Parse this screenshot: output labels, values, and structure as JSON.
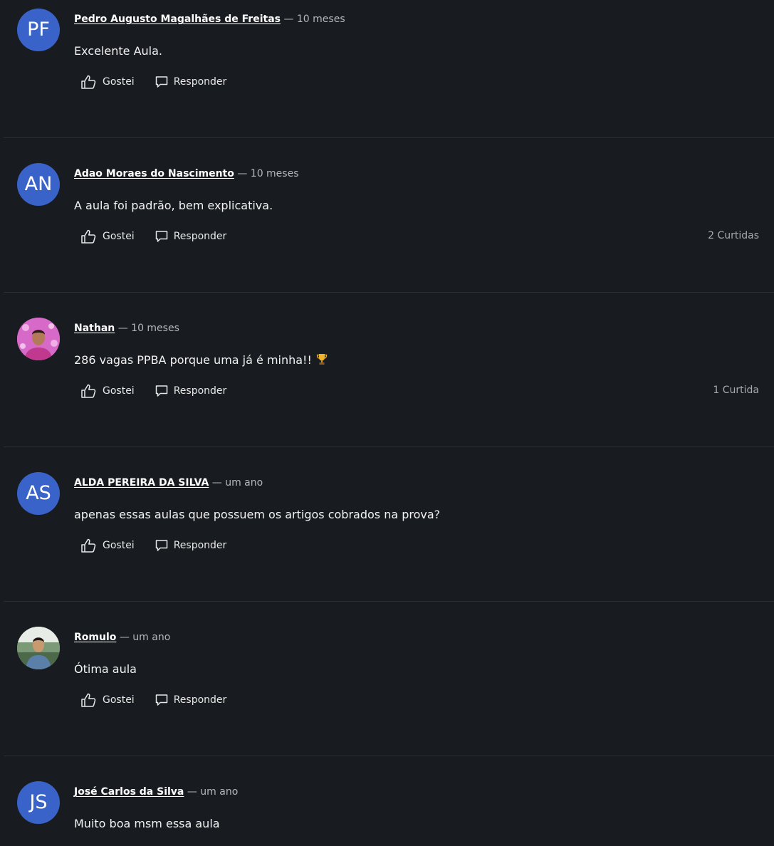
{
  "colors": {
    "background": "#181c20",
    "avatar_bg": "#3a63c9",
    "divider": "#2a2f35",
    "muted_text": "#b4b8bd"
  },
  "dash": "—",
  "actions": {
    "like_label": "Gostei",
    "like_icon": "thumbs-up-icon",
    "reply_label": "Responder",
    "reply_icon": "speech-bubble-icon"
  },
  "comments": [
    {
      "initials": "PF",
      "author": "Pedro Augusto Magalhães de Freitas",
      "time": "10 meses",
      "text": "Excelente Aula.",
      "likes": ""
    },
    {
      "initials": "AN",
      "author": "Adao Moraes do Nascimento",
      "time": "10 meses",
      "text": "A aula foi padrão, bem explicativa.",
      "likes": "2 Curtidas"
    },
    {
      "initials": "",
      "avatar_icon": "user-photo-icon",
      "author": "Nathan",
      "time": "10 meses",
      "text": "286 vagas PPBA porque uma já é minha!!",
      "trailing_icon": "trophy-icon",
      "likes": "1 Curtida"
    },
    {
      "initials": "AS",
      "author": "ALDA PEREIRA DA SILVA",
      "time": "um ano",
      "text": "apenas essas aulas que possuem os artigos cobrados na prova?",
      "likes": ""
    },
    {
      "initials": "",
      "avatar_icon": "user-photo-icon",
      "author": "Romulo",
      "time": "um ano",
      "text": "Ótima aula",
      "likes": ""
    },
    {
      "initials": "JS",
      "author": "José Carlos da Silva",
      "time": "um ano",
      "text": "Muito boa msm essa aula",
      "likes": ""
    }
  ]
}
